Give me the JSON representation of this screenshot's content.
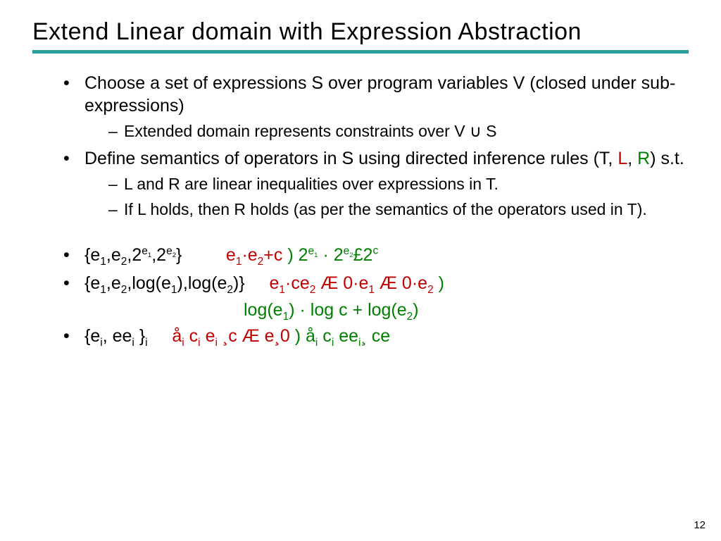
{
  "title": "Extend Linear domain with Expression Abstraction",
  "bullets": {
    "b1": "Choose a set of expressions S over program variables V (closed under sub-expressions)",
    "b1s1_a": "Extended domain represents constraints over V ",
    "b1s1_b": " S",
    "b2_a": "Define semantics of operators in S using directed inference rules (T, ",
    "b2_L": "L",
    "b2_mid": ", ",
    "b2_R": "R",
    "b2_end": ") s.t.",
    "b2s1": "L and R are linear inequalities over expressions in T.",
    "b2s2": "If L holds, then R holds (as per the semantics of the operators used in T)."
  },
  "sym": {
    "cup": "∪",
    "le": "·",
    "times": "£",
    "and": "Æ",
    "implies": ")",
    "ge": "¸",
    "sigma": "å"
  },
  "page": "12"
}
